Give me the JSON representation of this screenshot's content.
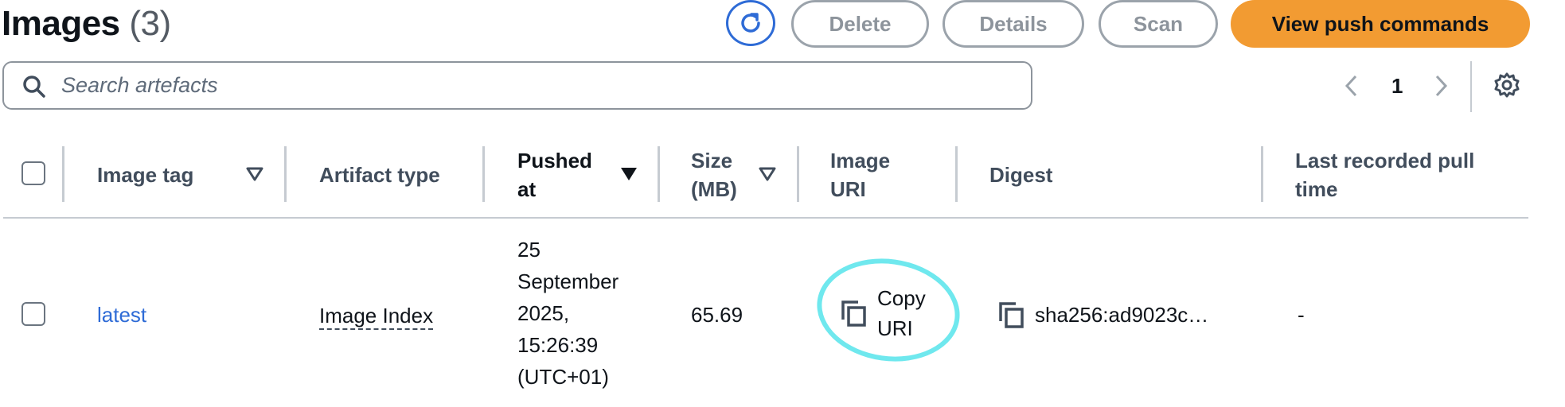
{
  "header": {
    "title": "Images",
    "count": "(3)",
    "buttons": {
      "refresh_icon": "refresh-icon",
      "delete": "Delete",
      "details": "Details",
      "scan": "Scan",
      "primary": "View push commands"
    }
  },
  "search": {
    "placeholder": "Search artefacts"
  },
  "pagination": {
    "current_page": "1"
  },
  "table": {
    "columns": [
      {
        "label": "Image tag",
        "sortable": true
      },
      {
        "label": "Artifact type",
        "sortable": false
      },
      {
        "label_line1": "Pushed",
        "label_line2": "at",
        "sortable": true,
        "sorted": "desc"
      },
      {
        "label_line1": "Size",
        "label_line2": "(MB)",
        "sortable": true
      },
      {
        "label_line1": "Image",
        "label_line2": "URI",
        "sortable": false
      },
      {
        "label": "Digest",
        "sortable": false
      },
      {
        "label_line1": "Last recorded pull",
        "label_line2": "time",
        "sortable": false
      }
    ],
    "rows": [
      {
        "image_tag": "latest",
        "artifact_type": "Image Index",
        "pushed_at_lines": [
          "25",
          "September",
          "2025,",
          "15:26:39",
          "(UTC+01)"
        ],
        "size_mb": "65.69",
        "image_uri_line1": "Copy",
        "image_uri_line2": "URI",
        "digest": "sha256:ad9023c…",
        "last_pull": "-"
      }
    ]
  },
  "colors": {
    "primary": "#f29b32",
    "link": "#2e6bd6",
    "highlight": "#6fe8ee"
  }
}
